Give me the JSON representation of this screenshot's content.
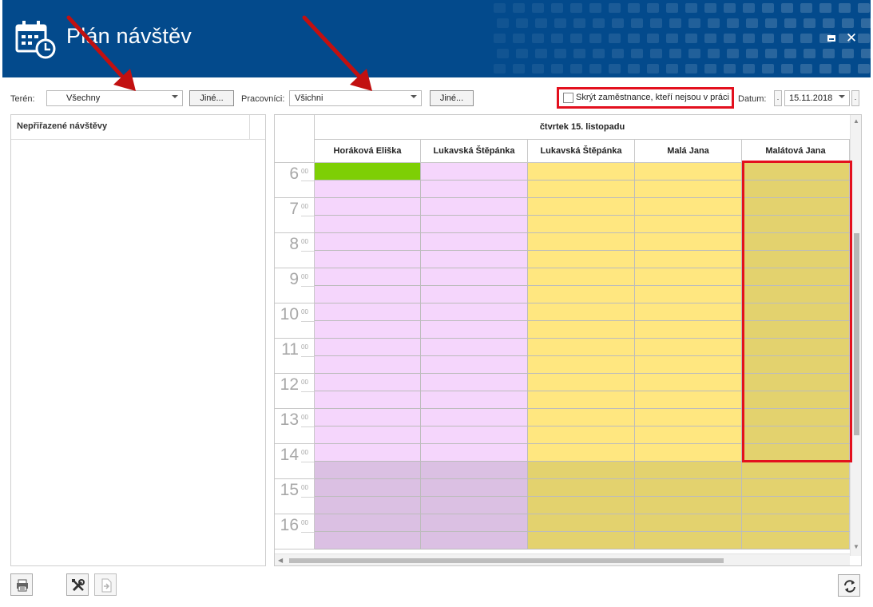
{
  "window": {
    "title": "Plán návštěv"
  },
  "toolbar": {
    "teren_label": "Terén:",
    "teren_value": "Všechny",
    "teren_other": "Jiné...",
    "workers_label": "Pracovníci:",
    "workers_value": "Všichni",
    "workers_other": "Jiné...",
    "hide_label": "Skrýt zaměstnance, kteří nejsou v práci",
    "hide_checked": false,
    "date_label": "Datum:",
    "date_prev": ".",
    "date_value": "15.11.2018",
    "date_next": "."
  },
  "unassigned": {
    "header": "Nepřiřazené návštěvy"
  },
  "calendar": {
    "date_header": "čtvrtek 15. listopadu",
    "columns": [
      {
        "name": "Horáková Eliška",
        "work": "#f5d6fc",
        "off": "#dbc0e3",
        "first": "#7ecf05"
      },
      {
        "name": "Lukavská Štěpánka",
        "work": "#f5d6fc",
        "off": "#dbc0e3"
      },
      {
        "name": "Lukavská Štěpánka",
        "work": "#ffe780",
        "off": "#e3d26e"
      },
      {
        "name": "Malá Jana",
        "work": "#ffe780",
        "off": "#e3d26e"
      },
      {
        "name": "Malátová Jana",
        "work": "#e3d26e",
        "off": "#e3d26e"
      }
    ],
    "hours": [
      {
        "h": "6",
        "m": "00"
      },
      {
        "h": "7",
        "m": "00"
      },
      {
        "h": "8",
        "m": "00"
      },
      {
        "h": "9",
        "m": "00"
      },
      {
        "h": "10",
        "m": "00"
      },
      {
        "h": "11",
        "m": "00"
      },
      {
        "h": "12",
        "m": "00"
      },
      {
        "h": "13",
        "m": "00"
      },
      {
        "h": "14",
        "m": "00"
      },
      {
        "h": "15",
        "m": "00"
      },
      {
        "h": "16",
        "m": "00"
      }
    ],
    "work_until_row": 17
  },
  "colors": {
    "titlebar": "#034a8c",
    "annotation": "#e3101e"
  },
  "icons": {
    "app": "calendar-clock-icon",
    "maximize": "maximize-icon",
    "close": "close-icon",
    "print": "print-icon",
    "settings": "tools-icon",
    "export": "export-icon",
    "refresh": "refresh-icon"
  }
}
